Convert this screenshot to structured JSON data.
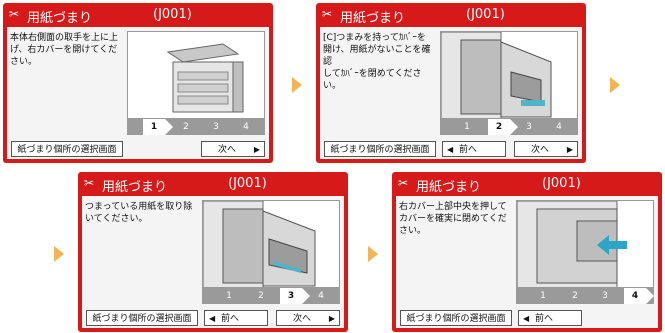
{
  "panels": [
    {
      "title": "用紙づまり",
      "code": "(J001)",
      "instruction": "本体右側面の取手を上に上\nげ、右カバーを開けてくだ\nさい。",
      "active_step": "1",
      "steps": [
        "1",
        "2",
        "3",
        "4"
      ],
      "select_button": "紙づまり個所の選択画面",
      "prev_button": "",
      "next_button": "次へ"
    },
    {
      "title": "用紙づまり",
      "code": "(J001)",
      "instruction": "[C]つまみを持ってｶﾊﾞｰを\n開け、用紙がないことを確認\nしてｶﾊﾞｰを閉めてください。",
      "active_step": "2",
      "steps": [
        "1",
        "2",
        "3",
        "4"
      ],
      "select_button": "紙づまり個所の選択画面",
      "prev_button": "前へ",
      "next_button": "次へ"
    },
    {
      "title": "用紙づまり",
      "code": "(J001)",
      "instruction": "つまっている用紙を取り除\nいてください。",
      "active_step": "3",
      "steps": [
        "1",
        "2",
        "3",
        "4"
      ],
      "select_button": "紙づまり個所の選択画面",
      "prev_button": "前へ",
      "next_button": "次へ"
    },
    {
      "title": "用紙づまり",
      "code": "(J001)",
      "instruction": "右カバー上部中央を押して\nカバーを確実に閉めてくだ\nさい。",
      "active_step": "4",
      "steps": [
        "1",
        "2",
        "3",
        "4"
      ],
      "select_button": "紙づまり個所の選択画面",
      "prev_button": "前へ",
      "next_button": ""
    }
  ],
  "colors": {
    "header": "#d61a1a",
    "sequence_arrow": "#f6b351",
    "step_bar": "#9a9a9a"
  },
  "icons": {
    "header": "jam-icon",
    "prev": "triangle-left-icon",
    "next": "triangle-right-icon"
  }
}
